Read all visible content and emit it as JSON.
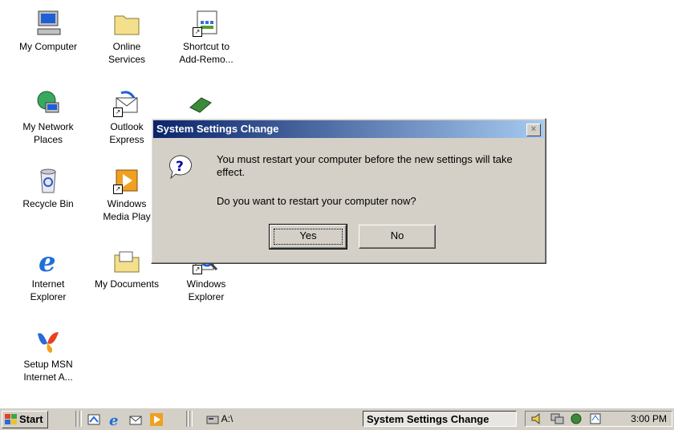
{
  "desktop": {
    "icons": [
      {
        "label": "My Computer",
        "icon": "my-computer-icon"
      },
      {
        "label": "Online\nServices",
        "icon": "folder-icon"
      },
      {
        "label": "Shortcut to\nAdd-Remo...",
        "icon": "add-remove-programs-icon"
      },
      {
        "label": "My Network\nPlaces",
        "icon": "network-places-icon"
      },
      {
        "label": "Outlook\nExpress",
        "icon": "outlook-express-icon"
      },
      {
        "label": "Recycle Bin",
        "icon": "recycle-bin-icon"
      },
      {
        "label": "Windows\nMedia Play",
        "icon": "media-player-icon"
      },
      {
        "label": "Internet\nExplorer",
        "icon": "internet-explorer-icon"
      },
      {
        "label": "My Documents",
        "icon": "my-documents-icon"
      },
      {
        "label": "Windows\nExplorer",
        "icon": "windows-explorer-icon"
      },
      {
        "label": "Setup MSN\nInternet A...",
        "icon": "msn-icon"
      }
    ]
  },
  "dialog": {
    "title": "System Settings Change",
    "close_glyph": "×",
    "message": "You must restart your computer before the new settings will take effect.",
    "question": "Do you want to restart your computer now?",
    "yes_label": "Yes",
    "no_label": "No",
    "icon": "question-icon"
  },
  "taskbar": {
    "start_label": "Start",
    "quick_launch": [
      "show-desktop-icon",
      "internet-explorer-icon",
      "outlook-express-icon",
      "media-player-icon"
    ],
    "task_a_label": "A:\\",
    "active_task_label": "System Settings Change",
    "tray_icons": [
      "volume-icon",
      "network-icon",
      "tray-app-icon",
      "scheduler-icon"
    ],
    "clock": "3:00 PM"
  },
  "colors": {
    "titlebar_start": "#0a246a",
    "titlebar_end": "#a6caf0",
    "face": "#d4d0c8"
  }
}
